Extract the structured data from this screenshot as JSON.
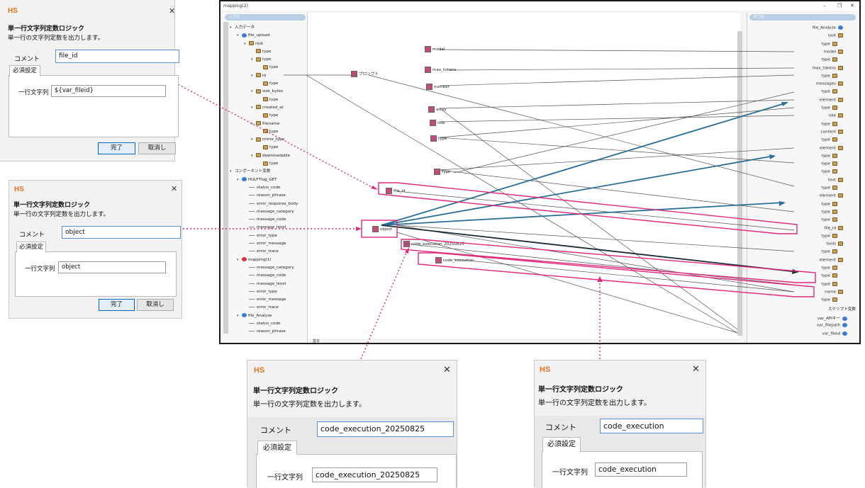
{
  "main_window": {
    "title": "mapping(2)",
    "controls": [
      "–",
      "❐",
      "✕"
    ],
    "left_header": "入力元",
    "right_header": "出力先",
    "left_tree": [
      {
        "d": 0,
        "t": "入力データ",
        "i": "none",
        "c": "▾"
      },
      {
        "d": 1,
        "t": "file_upload",
        "i": "globe",
        "c": "▾"
      },
      {
        "d": 2,
        "t": "root",
        "i": "folder",
        "c": "▾"
      },
      {
        "d": 3,
        "t": "type",
        "i": "folder",
        "c": ""
      },
      {
        "d": 3,
        "t": "type",
        "i": "folder",
        "c": "▾"
      },
      {
        "d": 4,
        "t": "type",
        "i": "folder",
        "c": ""
      },
      {
        "d": 3,
        "t": "id",
        "i": "folder",
        "c": "▾"
      },
      {
        "d": 4,
        "t": "type",
        "i": "folder",
        "c": ""
      },
      {
        "d": 3,
        "t": "size_bytes",
        "i": "folder",
        "c": "▾"
      },
      {
        "d": 4,
        "t": "type",
        "i": "folder",
        "c": ""
      },
      {
        "d": 3,
        "t": "created_at",
        "i": "folder",
        "c": "▾"
      },
      {
        "d": 4,
        "t": "type",
        "i": "folder",
        "c": ""
      },
      {
        "d": 3,
        "t": "filename",
        "i": "folder",
        "c": "▾"
      },
      {
        "d": 4,
        "t": "type",
        "i": "folder",
        "c": ""
      },
      {
        "d": 3,
        "t": "mime_type",
        "i": "folder",
        "c": "▾"
      },
      {
        "d": 4,
        "t": "type",
        "i": "folder",
        "c": ""
      },
      {
        "d": 3,
        "t": "downloadable",
        "i": "folder",
        "c": "▾"
      },
      {
        "d": 4,
        "t": "type",
        "i": "folder",
        "c": ""
      },
      {
        "d": 0,
        "t": "コンポーネント変数",
        "i": "none",
        "c": "▾"
      },
      {
        "d": 1,
        "t": "HULFTlog_GET",
        "i": "globe",
        "c": "▾"
      },
      {
        "d": 2,
        "t": "status_code",
        "i": "none",
        "c": ""
      },
      {
        "d": 2,
        "t": "reason_phrase",
        "i": "none",
        "c": ""
      },
      {
        "d": 2,
        "t": "error_response_body",
        "i": "none",
        "c": ""
      },
      {
        "d": 2,
        "t": "message_category",
        "i": "none",
        "c": ""
      },
      {
        "d": 2,
        "t": "message_code",
        "i": "none",
        "c": ""
      },
      {
        "d": 2,
        "t": "message_level",
        "i": "none",
        "c": ""
      },
      {
        "d": 2,
        "t": "error_type",
        "i": "none",
        "c": ""
      },
      {
        "d": 2,
        "t": "error_message",
        "i": "none",
        "c": ""
      },
      {
        "d": 2,
        "t": "error_trace",
        "i": "none",
        "c": ""
      },
      {
        "d": 1,
        "t": "mapping(1)",
        "i": "red",
        "c": "▾"
      },
      {
        "d": 2,
        "t": "message_category",
        "i": "none",
        "c": ""
      },
      {
        "d": 2,
        "t": "message_code",
        "i": "none",
        "c": ""
      },
      {
        "d": 2,
        "t": "message_level",
        "i": "none",
        "c": ""
      },
      {
        "d": 2,
        "t": "error_type",
        "i": "none",
        "c": ""
      },
      {
        "d": 2,
        "t": "error_message",
        "i": "none",
        "c": ""
      },
      {
        "d": 2,
        "t": "error_trace",
        "i": "none",
        "c": ""
      },
      {
        "d": 1,
        "t": "file_Analyze",
        "i": "globe",
        "c": "▾"
      },
      {
        "d": 2,
        "t": "status_code",
        "i": "none",
        "c": ""
      },
      {
        "d": 2,
        "t": "reason_phrase",
        "i": "none",
        "c": ""
      }
    ],
    "right_tree": [
      "file_Analyze",
      "root",
      "type",
      "model",
      "type",
      "max_tokens",
      "type",
      "messages",
      "type",
      "element",
      "type",
      "role",
      "type",
      "content",
      "type",
      "element",
      "type",
      "type",
      "type",
      "text",
      "type",
      "element",
      "type",
      "type",
      "type",
      "file_id",
      "type",
      "tools",
      "type",
      "element",
      "type",
      "type",
      "type",
      "name",
      "type"
    ],
    "right_vars_header": "スクリプト変数",
    "right_vars": [
      "var_APIキー",
      "var_filepath",
      "var_fileid"
    ],
    "canvas_nodes": [
      "model",
      "max_tokens",
      "number",
      "プロンプト",
      "array",
      "role",
      "type",
      "type",
      "file_id",
      "object",
      "code_execution_20250825",
      "code_execution"
    ],
    "bottom_tab": "基本"
  },
  "dialogs": [
    {
      "hs": "HS",
      "close": "✕",
      "title": "単一行文字列定数ロジック",
      "desc": "単一行の文字列定数を出力します。",
      "comment_label": "コメント",
      "comment": "file_id",
      "tab": "必須設定",
      "field_label": "一行文字列",
      "field": "${var_fileid}",
      "ok": "完了",
      "cancel": "取消し"
    },
    {
      "hs": "HS",
      "close": "✕",
      "title": "単一行文字列定数ロジック",
      "desc": "単一行の文字列定数を出力します。",
      "comment_label": "コメント",
      "comment": "object",
      "tab": "必須設定",
      "field_label": "一行文字列",
      "field": "object",
      "ok": "完了",
      "cancel": "取消し"
    },
    {
      "hs": "HS",
      "close": "✕",
      "title": "単一行文字列定数ロジック",
      "desc": "単一行の文字列定数を出力します。",
      "comment_label": "コメント",
      "comment": "code_execution_20250825",
      "tab": "必須設定",
      "field_label": "一行文字列",
      "field": "code_execution_20250825"
    },
    {
      "hs": "HS",
      "close": "✕",
      "title": "単一行文字列定数ロジック",
      "desc": "単一行の文字列定数を出力します。",
      "comment_label": "コメント",
      "comment": "code_execution",
      "tab": "必須設定",
      "field_label": "一行文字列",
      "field": "code_execution"
    }
  ],
  "colors": {
    "accent_line": "#2a6f97",
    "dark_line": "#1b2a3a",
    "highlight": "#e0297a",
    "hs_brand": "#e8731c"
  }
}
